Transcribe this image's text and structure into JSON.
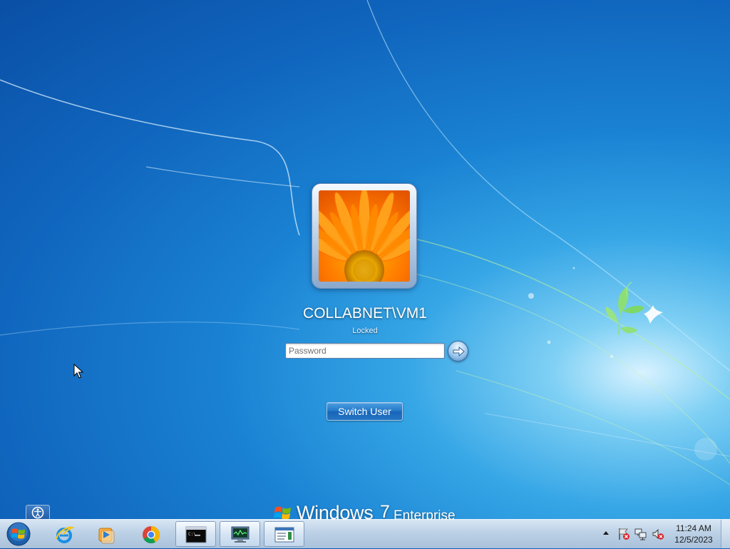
{
  "login": {
    "user_name": "COLLABNET\\VM1",
    "status": "Locked",
    "password_placeholder": "Password",
    "switch_user_label": "Switch User"
  },
  "branding": {
    "product": "Windows",
    "version": "7",
    "edition": "Enterprise"
  },
  "taskbar": {
    "pinned": [
      {
        "name": "internet-explorer",
        "icon": "ie-icon"
      },
      {
        "name": "media-player",
        "icon": "media-player-icon"
      },
      {
        "name": "chrome",
        "icon": "chrome-icon"
      },
      {
        "name": "command-prompt",
        "icon": "cmd-icon",
        "active": true
      },
      {
        "name": "network-monitor",
        "icon": "monitor-icon",
        "active": true
      },
      {
        "name": "notepad",
        "icon": "notepad-icon",
        "active": true
      }
    ],
    "tray_icons": [
      "action-center-icon",
      "network-icon",
      "volume-muted-icon"
    ],
    "clock": {
      "time": "11:24 AM",
      "date": "12/5/2023"
    }
  },
  "colors": {
    "wallpaper_blue": "#1a82d3",
    "accent_green": "#7ed957",
    "switch_user_bg": "#2277c8"
  }
}
